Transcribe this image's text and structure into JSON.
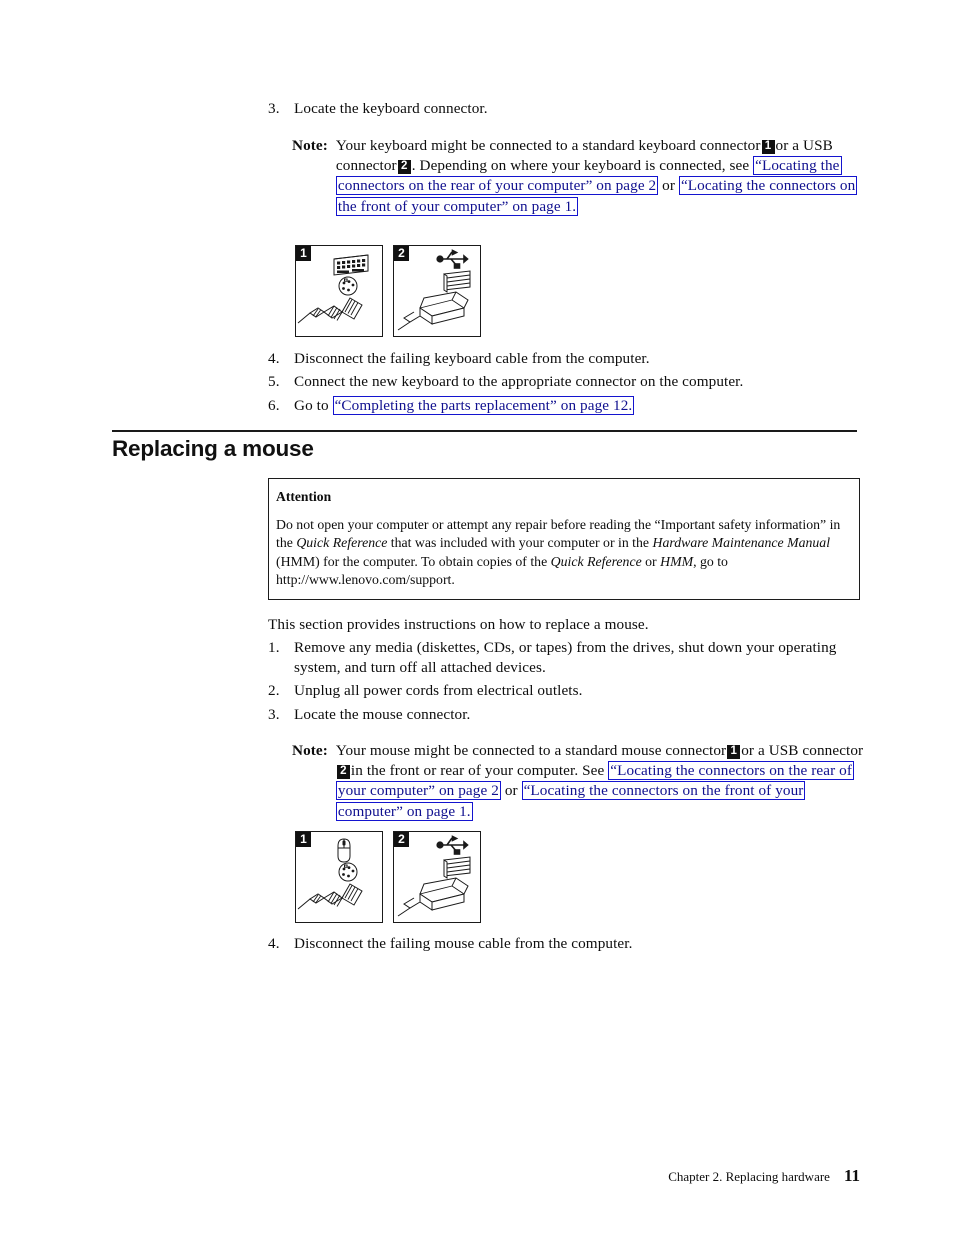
{
  "document": {
    "title": "Replacing a mouse",
    "footer": {
      "chapter": "Chapter 2. Replacing hardware",
      "page_number": "11"
    }
  },
  "keyboard_section": {
    "step3": {
      "num": "3.",
      "text": "Locate the keyboard connector."
    },
    "note": {
      "label": "Note:",
      "part1": "Your keyboard might be connected to a standard keyboard connector",
      "chip1": "1",
      "part2": "or a USB connector",
      "chip2": "2",
      "part3": ". Depending on where your keyboard is connected, see",
      "link1": "“Locating the connectors on the rear of your computer” on page 2",
      "conjunction": "or",
      "link2": "“Locating the connectors on the front of your computer” on page 1.",
      "tail": ""
    },
    "figures": [
      {
        "tag": "1",
        "icon": "ps2-keyboard-connector"
      },
      {
        "tag": "2",
        "icon": "usb-connector"
      }
    ],
    "step4": {
      "num": "4.",
      "text": "Disconnect the failing keyboard cable from the computer."
    },
    "step5": {
      "num": "5.",
      "text": "Connect the new keyboard to the appropriate connector on the computer."
    },
    "step6": {
      "num": "6.",
      "prefix": "Go to",
      "link": "“Completing the parts replacement” on page 12."
    }
  },
  "mouse_section": {
    "heading": "Replacing a mouse",
    "attention": {
      "title": "Attention",
      "text_part1": "Do not open your computer or attempt any repair before reading the “Important safety information” in the ",
      "italic1": "Quick Reference",
      "text_part2": " that was included with your computer or in the ",
      "italic2": "Hardware Maintenance Manual",
      "text_part3": " (HMM) for the computer. To obtain copies of the ",
      "italic3": "Quick Reference",
      "text_part4": " or ",
      "italic4": "HMM",
      "text_part5": ", go to http://www.lenovo.com/support."
    },
    "intro": "This section provides instructions on how to replace a mouse.",
    "step1": {
      "num": "1.",
      "text": "Remove any media (diskettes, CDs, or tapes) from the drives, shut down your operating system, and turn off all attached devices."
    },
    "step2": {
      "num": "2.",
      "text": "Unplug all power cords from electrical outlets."
    },
    "step3": {
      "num": "3.",
      "text": "Locate the mouse connector."
    },
    "note": {
      "label": "Note:",
      "part1": "Your mouse might be connected to a standard mouse connector",
      "chip1": "1",
      "part2": "or a USB connector",
      "chip2": "2",
      "part3": "in the front or rear of your computer. See",
      "link1": "“Locating the connectors on the rear of your computer” on page 2",
      "conjunction": "or",
      "link2": "“Locating the connectors on the front of your computer” on page 1."
    },
    "figures": [
      {
        "tag": "1",
        "icon": "ps2-mouse-connector"
      },
      {
        "tag": "2",
        "icon": "usb-connector"
      }
    ],
    "step4": {
      "num": "4.",
      "text": "Disconnect the failing mouse cable from the computer."
    }
  },
  "colors": {
    "link": "#10108f",
    "link_border": "#1414cf",
    "text": "#0d0d0d",
    "chip_bg": "#111111"
  }
}
